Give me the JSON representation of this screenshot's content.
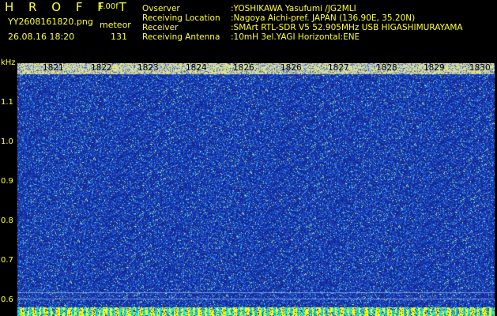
{
  "header": {
    "app_title": "H R O F F T",
    "version": "1.00f",
    "filename": "YY2608161820.png",
    "mode": "meteor",
    "datetime": "26.08.16 18:20",
    "count": "131"
  },
  "info": {
    "observer_label": "Ovserver",
    "observer_value": ":YOSHIKAWA Yasufumi /JG2MLI",
    "location_label": "Receiving Location",
    "location_value": ":Nagoya Aichi-pref. JAPAN (136.90E, 35.20N)",
    "receiver_label": "Receiver",
    "receiver_value": ":SMArt RTL-SDR V5 52.905MHz USB HIGASHIMURAYAMA",
    "antenna_label": "Receiving Antenna",
    "antenna_value": ":10mH 3el.YAGI Horizontal:ENE"
  },
  "y_axis": {
    "unit": "kHz",
    "labels": [
      "1.1",
      "1.0",
      "0.9",
      "0.8",
      "0.7",
      "0.6"
    ]
  },
  "x_axis": {
    "labels": [
      "1821",
      "1822",
      "1823",
      "1824",
      "1826",
      "1826",
      "1827",
      "1828",
      "1829",
      "1830"
    ]
  },
  "colors": {
    "text": "#ffff33",
    "background": "#000000",
    "spectrogram_base": "#1a3aa8",
    "bottom_band_yellow": "#ffff00",
    "bottom_band_cyan": "#00ffff"
  }
}
